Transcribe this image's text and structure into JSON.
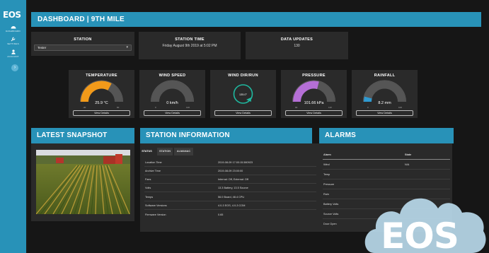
{
  "brand": {
    "logo": "EOS"
  },
  "sidebar": {
    "items": [
      {
        "label": "DASHBOARD",
        "icon": "dashboard-icon"
      },
      {
        "label": "SETTINGS",
        "icon": "wrench-icon"
      },
      {
        "label": "ACCOUNT",
        "icon": "user-icon"
      }
    ],
    "collapse_glyph": "›"
  },
  "header": {
    "title": "DASHBOARD | 9TH MILE"
  },
  "station": {
    "label": "STATION",
    "selected": "Tester",
    "caret": "▾"
  },
  "station_time": {
    "label": "STATION TIME",
    "value": "Friday August 9th 2019 at 5:02 PM"
  },
  "data_updates": {
    "label": "DATA UPDATES",
    "value": "130"
  },
  "gauges": [
    {
      "title": "TEMPERATURE",
      "value": "25.9 °C",
      "min": "-40",
      "max": "60",
      "fill": 0.66,
      "color": "#f29a1a",
      "button": "View Details"
    },
    {
      "title": "WIND SPEED",
      "value": "0 km/h",
      "min": "0",
      "max": "120",
      "fill": 0.0,
      "color": "#888888",
      "button": "View Details"
    },
    {
      "title": "WIND DIR/RUN",
      "value": "135.0°",
      "button": "View Details"
    },
    {
      "title": "PRESSURE",
      "value": "101.66 kPa",
      "min": "90",
      "max": "110",
      "fill": 0.58,
      "color": "#b56fd6",
      "button": "View Details"
    },
    {
      "title": "RAINFALL",
      "value": "8.2 mm",
      "min": "0",
      "max": "100",
      "fill": 0.08,
      "color": "#2f9ad1",
      "button": "View Details"
    }
  ],
  "snapshot": {
    "title": "LATEST SNAPSHOT"
  },
  "station_info": {
    "title": "STATION INFORMATION",
    "tabs": [
      "STATUS",
      "STATION",
      "ALMANAC"
    ],
    "rows": [
      {
        "k": "Location Time",
        "v": "2019-08-09 17:00:15.580923"
      },
      {
        "k": "Archive Time",
        "v": "2019-08-09 23:00:00"
      },
      {
        "k": "Fans",
        "v": "Internal: Off, External: Off"
      },
      {
        "k": "Volts",
        "v": "13.3 Battery, 13.5 Source"
      },
      {
        "k": "Temps",
        "v": "56.0 Board, 48.4 CPU"
      },
      {
        "k": "Software Versions",
        "v": "4.0-3 EOS, 4.0-3 COM"
      },
      {
        "k": "Firmware Version",
        "v": "0.65"
      }
    ]
  },
  "alarms": {
    "title": "ALARMS",
    "header": {
      "k": "Alarm",
      "v": "State"
    },
    "rows": [
      {
        "k": "Wind",
        "v": "N/A"
      },
      {
        "k": "Temp",
        "v": ""
      },
      {
        "k": "Pressure",
        "v": ""
      },
      {
        "k": "Rain",
        "v": ""
      },
      {
        "k": "Battery Volts",
        "v": ""
      },
      {
        "k": "Source Volts",
        "v": ""
      },
      {
        "k": "Door Open",
        "v": ""
      }
    ]
  },
  "watermark": {
    "text": "EOS"
  }
}
